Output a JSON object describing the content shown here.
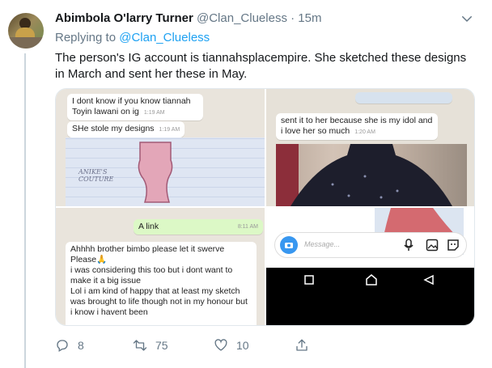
{
  "tweet": {
    "author_name": "Abimbola O'larry Turner",
    "handle": "@Clan_Clueless",
    "dot": "·",
    "time": "15m",
    "replying_prefix": "Replying to",
    "replying_to": "@Clan_Clueless",
    "text": "The person's IG account is tiannahsplacempire. She sketched these designs in March and sent her these in May."
  },
  "media": {
    "q1": {
      "msg1": "I dont know if you know tiannah Toyin lawani on ig",
      "msg1_time": "1:19 AM",
      "msg2": "SHe stole my designs",
      "msg2_time": "1:19 AM",
      "sketch_text": "ANIKE'S COUTURE"
    },
    "q2": {
      "msg": "sent it to her because she is my idol and i love her so much",
      "msg_time": "1:20 AM"
    },
    "q3": {
      "green_msg": "A link",
      "green_time": "8:11 AM",
      "m1": "Ahhhh brother bimbo please let it swerve",
      "m2": "Please🙏",
      "m3": "i was considering this too but i dont want to make it a big issue",
      "m4": "Lol i am kind of happy that at least my sketch was brought to life though not in my honour but i know i havent been"
    },
    "q4": {
      "placeholder": "Message..."
    }
  },
  "actions": {
    "replies": "8",
    "retweets": "75",
    "likes": "10"
  },
  "colors": {
    "accent": "#1da1f2",
    "muted": "#657786",
    "whatsapp_green": "#dcf8c6"
  }
}
